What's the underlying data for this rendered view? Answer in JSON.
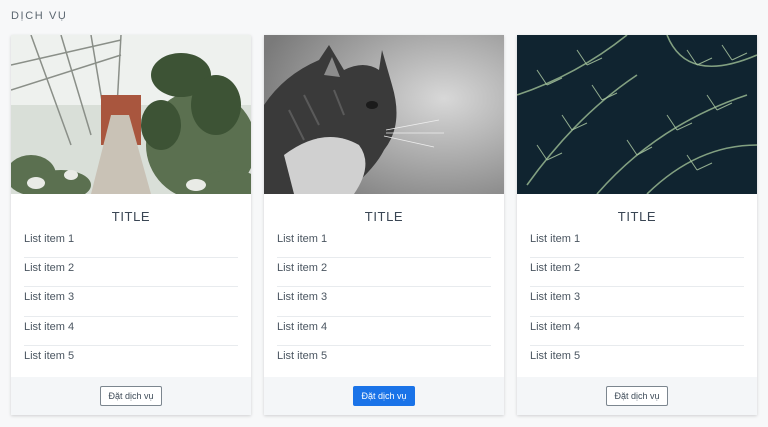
{
  "section": {
    "title": "DỊCH VỤ"
  },
  "cards": [
    {
      "title": "TITLE",
      "items": [
        "List item 1",
        "List item 2",
        "List item 3",
        "List item 4",
        "List item 5"
      ],
      "button_label": "Đặt dịch vụ",
      "button_style": "outline",
      "image": "greenhouse-photo"
    },
    {
      "title": "TITLE",
      "items": [
        "List item 1",
        "List item 2",
        "List item 3",
        "List item 4",
        "List item 5"
      ],
      "button_label": "Đặt dịch vụ",
      "button_style": "primary",
      "image": "cat-photo"
    },
    {
      "title": "TITLE",
      "items": [
        "List item 1",
        "List item 2",
        "List item 3",
        "List item 4",
        "List item 5"
      ],
      "button_label": "Đặt dịch vụ",
      "button_style": "outline",
      "image": "fern-photo"
    }
  ],
  "colors": {
    "primary": "#1a73e8",
    "footer_bg": "#f4f6f8",
    "page_bg": "#f7f8f9"
  }
}
